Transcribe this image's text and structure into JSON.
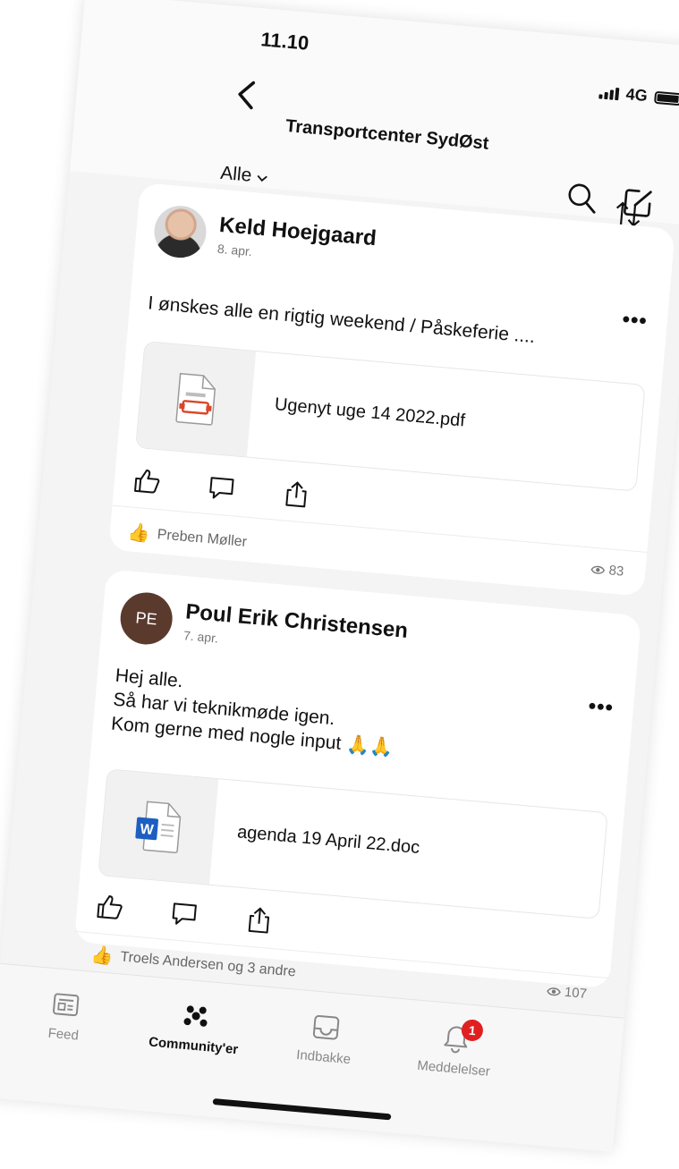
{
  "status": {
    "time": "11.10",
    "network": "4G"
  },
  "header": {
    "title": "Transportcenter SydØst",
    "filter_label": "Alle"
  },
  "posts": [
    {
      "author": "Keld Hoejgaard",
      "date": "8. apr.",
      "text": [
        "I ønskes alle en rigtig weekend / Påskeferie ...."
      ],
      "attachment": {
        "name": "Ugenyt uge 14 2022.pdf",
        "icon": "pdf-file-icon"
      },
      "reactions": "Preben Møller",
      "views": "83"
    },
    {
      "author": "Poul Erik Christensen",
      "initials": "PE",
      "date": "7. apr.",
      "text": [
        "Hej alle.",
        "Så har vi teknikmøde igen.",
        "Kom gerne med nogle input 🙏🙏"
      ],
      "attachment": {
        "name": "agenda 19 April 22.doc",
        "icon": "word-file-icon"
      },
      "reactions": "Troels Andersen og 3 andre",
      "views": "107"
    }
  ],
  "tabs": [
    {
      "label": "Feed",
      "icon": "feed-icon"
    },
    {
      "label": "Community'er",
      "icon": "community-icon"
    },
    {
      "label": "Indbakke",
      "icon": "inbox-icon"
    },
    {
      "label": "Meddelelser",
      "icon": "bell-icon",
      "badge": "1"
    }
  ],
  "colors": {
    "accent": "#e02020",
    "avatar_pe": "#5b3a2e",
    "pdf": "#d9472b",
    "word": "#1d5fc1"
  }
}
